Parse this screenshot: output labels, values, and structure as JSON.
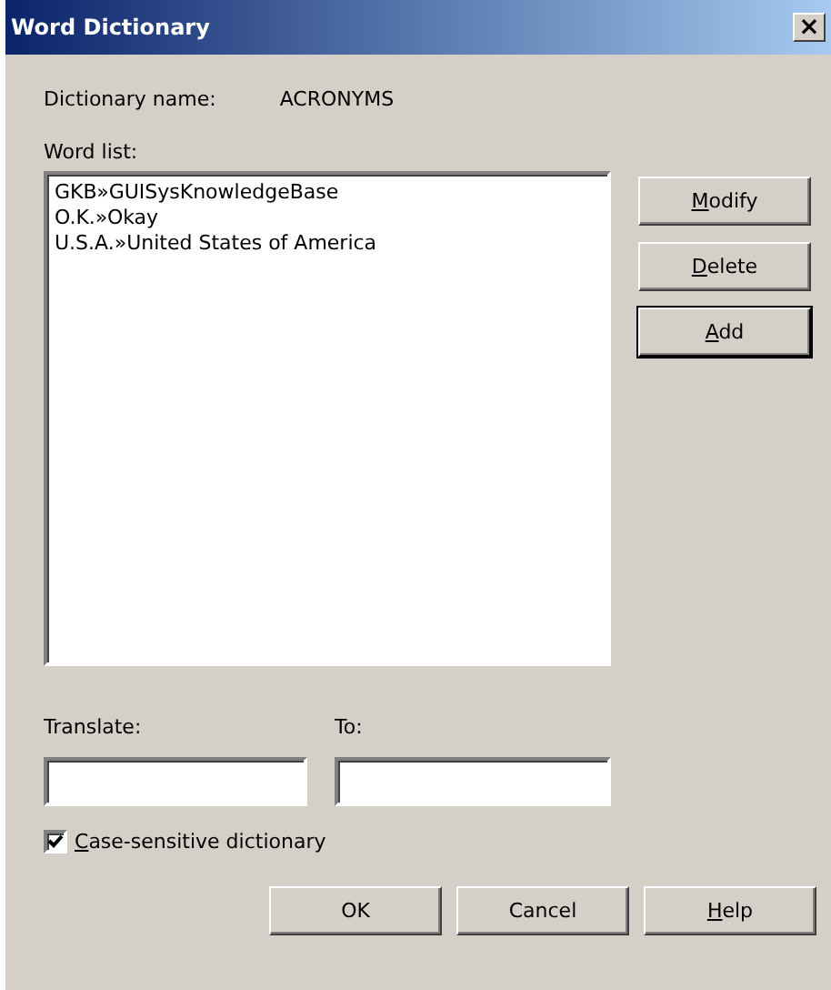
{
  "window": {
    "title": "Word Dictionary",
    "close": "×"
  },
  "dictionary_name": {
    "label": "Dictionary name:",
    "value": "ACRONYMS"
  },
  "word_list": {
    "label": "Word list:",
    "items": [
      {
        "text": "GKB»GUISysKnowledgeBase",
        "selected": false
      },
      {
        "text": "O.K.»Okay",
        "selected": false
      },
      {
        "text": "U.S.A.»United States of America",
        "selected": false
      }
    ]
  },
  "side_buttons": [
    {
      "label": "Modify",
      "first_letter_underlined": true,
      "default": false
    },
    {
      "label": "Delete",
      "first_letter_underlined": true,
      "default": false
    },
    {
      "label": "Add",
      "first_letter_underlined": true,
      "default": true
    }
  ],
  "translate": {
    "label": "Translate:"
  },
  "to": {
    "label": "To:"
  },
  "case_sensitive": {
    "label": "Case-sensitive dictionary",
    "first_letter_underlined": true,
    "checked": true
  },
  "bottom_buttons": [
    {
      "label": "OK",
      "first_letter_underlined": false,
      "default": false
    },
    {
      "label": "Cancel",
      "first_letter_underlined": false,
      "default": false
    },
    {
      "label": "Help",
      "first_letter_underlined": true,
      "default": false
    }
  ]
}
